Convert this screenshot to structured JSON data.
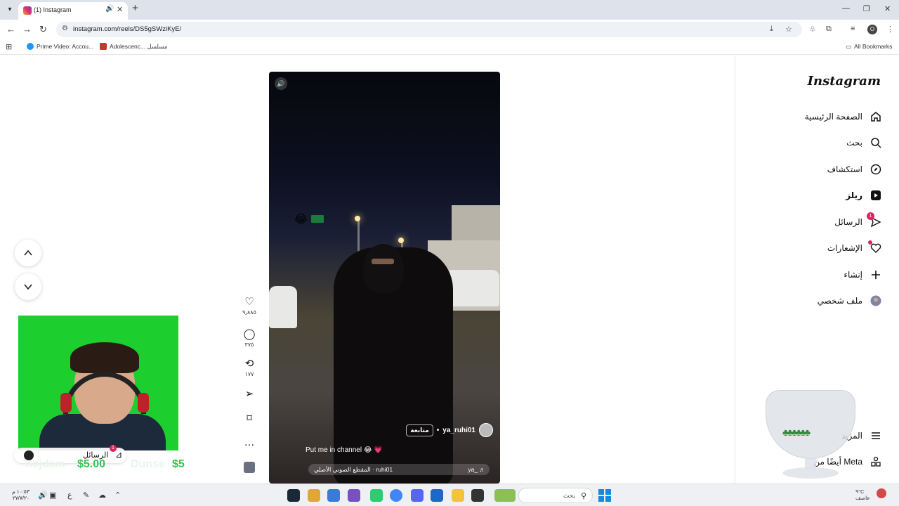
{
  "browser": {
    "tab_title": "(1) Instagram",
    "url": "instagram.com/reels/DS5gSWziKyE/",
    "bookmarks": [
      {
        "label": "Prime Video: Accou..."
      },
      {
        "label": "Adolescenc... مسلسل"
      }
    ],
    "all_bookmarks": "All Bookmarks",
    "profile_initial": "O"
  },
  "sidebar": {
    "logo": "Instagram",
    "items": [
      {
        "label": "الصفحة الرئيسية",
        "icon": "home-icon"
      },
      {
        "label": "بحث",
        "icon": "search-icon"
      },
      {
        "label": "استكشاف",
        "icon": "compass-icon"
      },
      {
        "label": "ريلز",
        "icon": "reels-icon"
      },
      {
        "label": "الرسائل",
        "icon": "messages-icon",
        "badge": "1"
      },
      {
        "label": "الإشعارات",
        "icon": "heart-icon"
      },
      {
        "label": "إنشاء",
        "icon": "plus-icon"
      },
      {
        "label": "ملف شخصي",
        "icon": "profile-avatar"
      }
    ],
    "more": "المزيد",
    "also_from_meta": "أيضًا من Meta"
  },
  "reel": {
    "username": "ya_ruhi01",
    "follow": "متابعة",
    "caption": "Put me in channel 😂 💗",
    "audio_left": "المقطع الصوتي الأصلي · ruhi01",
    "audio_right": "ya_ ♬",
    "likes": "٩٫٨٨٥",
    "comments": "٣٧٥",
    "reposts": "١٧٧"
  },
  "overlay": {
    "messages_label": "الرسائل",
    "messages_badge": "1",
    "donation_1": "$5.00",
    "donation_2": "$5"
  },
  "taskbar": {
    "time": "١٠:٥٣ م",
    "date": "٢٧/٧/٢٠",
    "lang": "ع",
    "search": "بحث",
    "temp": "٩°C",
    "weather": "عاصف"
  }
}
